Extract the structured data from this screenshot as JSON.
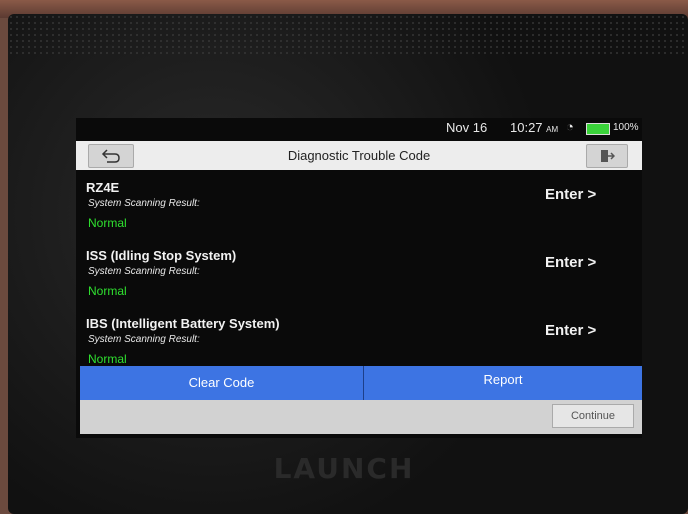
{
  "status": {
    "date": "Nov 16",
    "time": "10:27",
    "ampm": "AM",
    "battery": "100%"
  },
  "header": {
    "title": "Diagnostic Trouble Code"
  },
  "systems": [
    {
      "name": "RZ4E",
      "sub": "System Scanning Result:",
      "result": "Normal",
      "enter": "Enter >"
    },
    {
      "name": "ISS (Idling Stop System)",
      "sub": "System Scanning Result:",
      "result": "Normal",
      "enter": "Enter >"
    },
    {
      "name": "IBS (Intelligent Battery System)",
      "sub": "System Scanning Result:",
      "result": "Normal",
      "enter": "Enter >"
    }
  ],
  "actions": {
    "clear_code": "Clear Code",
    "report": "Report",
    "continue": "Continue"
  },
  "device": {
    "brand": "LAUNCH"
  }
}
